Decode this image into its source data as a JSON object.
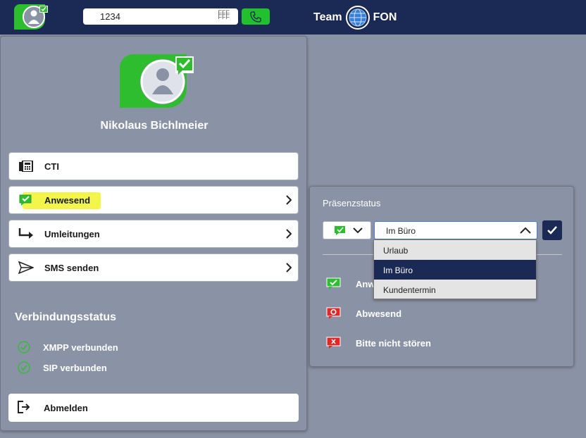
{
  "topbar": {
    "dial_value": "1234",
    "dial_pad_glyph": "FFF FFF",
    "logo_left": "Team",
    "logo_right": "FON"
  },
  "user": {
    "name": "Nikolaus Bichlmeier"
  },
  "menu": [
    {
      "label": "CTI",
      "icon": "phone-desk-icon",
      "has_chevron": false
    },
    {
      "label": "Anwesend",
      "icon": "presence-available-icon",
      "has_chevron": true
    },
    {
      "label": "Umleitungen",
      "icon": "forward-icon",
      "has_chevron": true
    },
    {
      "label": "SMS senden",
      "icon": "send-icon",
      "has_chevron": true
    }
  ],
  "connection": {
    "title": "Verbindungsstatus",
    "items": [
      {
        "label": "XMPP verbunden"
      },
      {
        "label": "SIP verbunden"
      }
    ]
  },
  "logout_label": "Abmelden",
  "presence_panel": {
    "title": "Präsenzstatus",
    "selected_text": "Im Büro",
    "options": [
      "Urlaub",
      "Im Büro",
      "Kundentermin"
    ],
    "statuses": [
      {
        "label": "Anwesend",
        "visible": "Anw",
        "color": "#2ebd2e"
      },
      {
        "label": "Abwesend",
        "color": "#e02828"
      },
      {
        "label": "Bitte nicht stören",
        "color": "#e02828"
      }
    ]
  },
  "colors": {
    "topbar": "#1b2a55",
    "panel": "#8a93a5",
    "accent_green": "#22c02e",
    "highlight": "#f4f54a"
  }
}
